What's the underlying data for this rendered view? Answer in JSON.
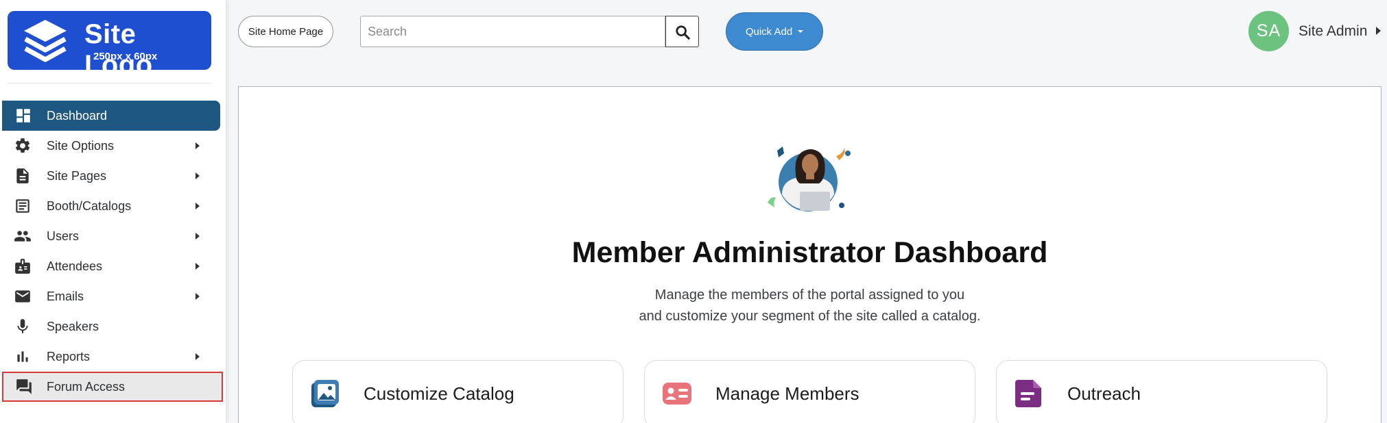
{
  "logo": {
    "title": "Site Logo",
    "subtitle": "250px x 60px",
    "color": "#1f4fd1"
  },
  "sidebar": {
    "items": [
      {
        "label": "Dashboard",
        "icon": "dashboard-icon",
        "has_submenu": false,
        "active": true
      },
      {
        "label": "Site Options",
        "icon": "gear-icon",
        "has_submenu": true
      },
      {
        "label": "Site Pages",
        "icon": "document-icon",
        "has_submenu": true
      },
      {
        "label": "Booth/Catalogs",
        "icon": "catalog-icon",
        "has_submenu": true
      },
      {
        "label": "Users",
        "icon": "users-icon",
        "has_submenu": true
      },
      {
        "label": "Attendees",
        "icon": "badge-icon",
        "has_submenu": true
      },
      {
        "label": "Emails",
        "icon": "mail-icon",
        "has_submenu": true
      },
      {
        "label": "Speakers",
        "icon": "microphone-icon",
        "has_submenu": false
      },
      {
        "label": "Reports",
        "icon": "bar-chart-icon",
        "has_submenu": true
      },
      {
        "label": "Forum Access",
        "icon": "forum-icon",
        "has_submenu": false,
        "highlighted": true
      }
    ]
  },
  "topbar": {
    "home_button": "Site Home Page",
    "search_placeholder": "Search",
    "quick_add": "Quick Add",
    "user_initials": "SA",
    "user_name": "Site Admin"
  },
  "main": {
    "title": "Member Administrator Dashboard",
    "subtitle_line1": "Manage the members of the portal assigned to you",
    "subtitle_line2": "and customize your segment of the site called a catalog.",
    "cards": [
      {
        "label": "Customize Catalog",
        "icon": "gallery-icon",
        "color": "#1e5782"
      },
      {
        "label": "Manage Members",
        "icon": "id-card-icon",
        "color": "#e8737a"
      },
      {
        "label": "Outreach",
        "icon": "note-icon",
        "color": "#7b2d83"
      }
    ]
  },
  "colors": {
    "active_nav": "#1e5782",
    "quick_add": "#3d8ad1",
    "avatar": "#6cc37f",
    "highlight_border": "#d9383a"
  }
}
